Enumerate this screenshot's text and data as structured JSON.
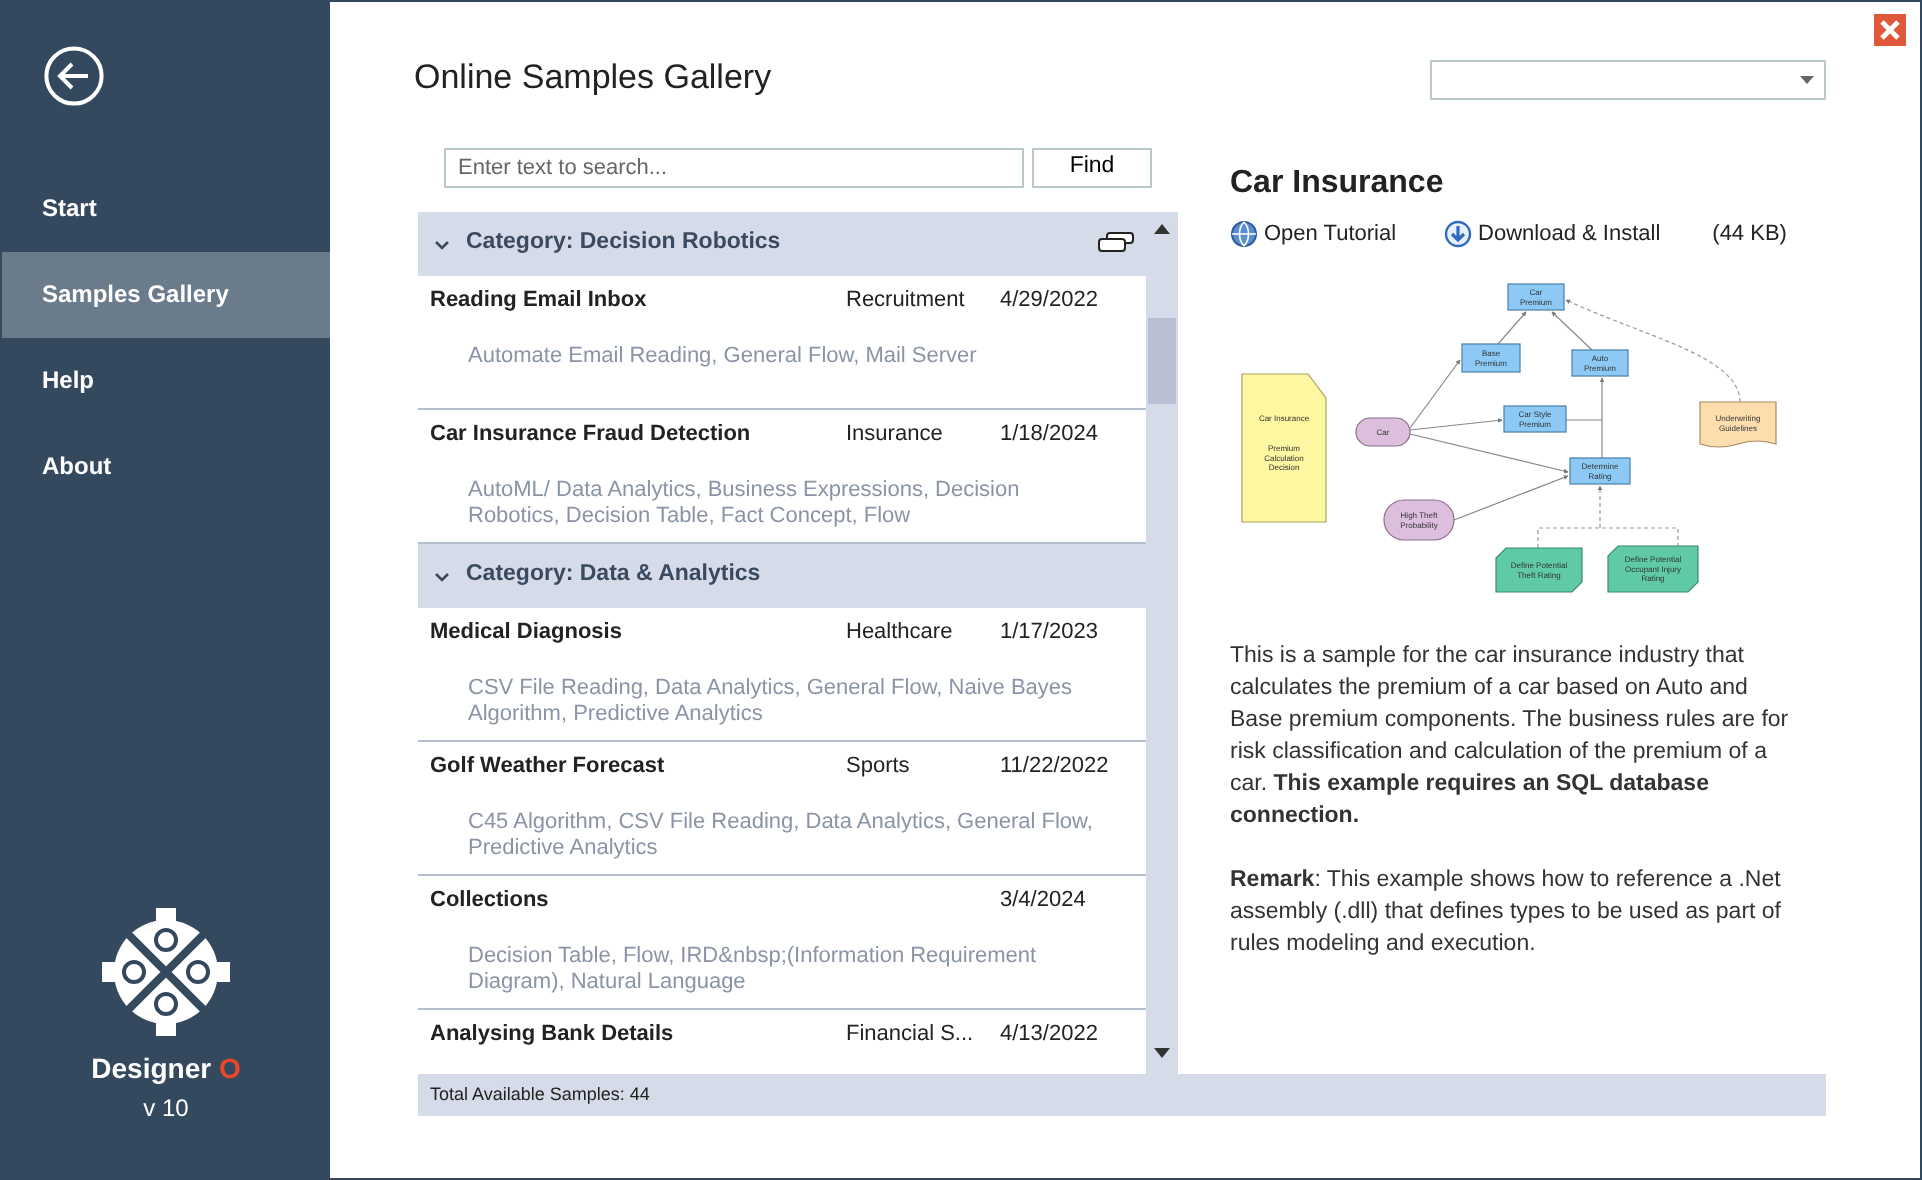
{
  "sidebar": {
    "items": [
      {
        "label": "Start",
        "selected": false
      },
      {
        "label": "Samples Gallery",
        "selected": true
      },
      {
        "label": "Help",
        "selected": false
      },
      {
        "label": "About",
        "selected": false
      }
    ],
    "product": {
      "name": "Designer",
      "accent": "O",
      "version": "v 10"
    }
  },
  "title": "Online Samples Gallery",
  "search": {
    "placeholder": "Enter text to search...",
    "button": "Find"
  },
  "groups": [
    {
      "category": "Category: Decision Robotics",
      "expanded": true,
      "samples": [
        {
          "name": "Reading Email Inbox",
          "industry": "Recruitment",
          "date": "4/29/2022",
          "tags": "Automate Email Reading, General Flow, Mail Server"
        },
        {
          "name": "Car Insurance Fraud Detection",
          "industry": "Insurance",
          "date": "1/18/2024",
          "tags": "AutoML/ Data Analytics, Business Expressions, Decision Robotics, Decision Table, Fact Concept, Flow"
        }
      ]
    },
    {
      "category": "Category: Data & Analytics",
      "expanded": true,
      "samples": [
        {
          "name": "Medical Diagnosis",
          "industry": "Healthcare",
          "date": "1/17/2023",
          "tags": "CSV File Reading, Data Analytics, General Flow, Naive Bayes Algorithm, Predictive Analytics"
        },
        {
          "name": "Golf Weather Forecast",
          "industry": "Sports",
          "date": "11/22/2022",
          "tags": "C45 Algorithm, CSV File Reading, Data Analytics, General Flow, Predictive Analytics"
        },
        {
          "name": "Collections",
          "date": "3/4/2024",
          "tags": "Decision Table, Flow, IRD&nbsp;(Information Requirement Diagram), Natural Language"
        },
        {
          "name": "Analysing Bank Details",
          "industry": "Financial S...",
          "date": "4/13/2022"
        }
      ]
    }
  ],
  "status_bar": "Total Available Samples: 44",
  "detail": {
    "title": "Car Insurance",
    "links": [
      {
        "label": "Open Tutorial",
        "kind": "globe"
      },
      {
        "label": "Download & Install",
        "kind": "download"
      }
    ],
    "size": "(44 KB)",
    "diagram": {
      "nodes": [
        {
          "kind": "decision",
          "lines": [
            "Car",
            "Premium"
          ]
        },
        {
          "kind": "decision",
          "lines": [
            "Base",
            "Premium"
          ]
        },
        {
          "kind": "decision",
          "lines": [
            "Auto",
            "Premium"
          ]
        },
        {
          "kind": "decision",
          "lines": [
            "Car Style",
            "Premium"
          ]
        },
        {
          "kind": "decision",
          "lines": [
            "Determine",
            "Rating"
          ]
        },
        {
          "kind": "input",
          "lines": [
            "Car"
          ]
        },
        {
          "kind": "input",
          "lines": [
            "High Theft",
            "Probability"
          ]
        },
        {
          "kind": "document",
          "lines": [
            "Car Insurance"
          ],
          "sub_lines": [
            "Premium",
            "Calculation",
            "Decision"
          ]
        },
        {
          "kind": "knowledge",
          "lines": [
            "Underwriting",
            "Guidelines"
          ]
        },
        {
          "kind": "source",
          "lines": [
            "Define Potential",
            "Theft Rating"
          ]
        },
        {
          "kind": "source",
          "lines": [
            "Define Potential",
            "Occupant Injury",
            "Rating"
          ]
        }
      ]
    },
    "description": "This is a sample for the car insurance industry that calculates the premium of a car based on Auto and Base premium components. The business rules are for risk classification and calculation of the premium of a car. **This example requires an SQL database connection.**",
    "remark": "**Remark**: This example shows how to reference a .Net assembly (.dll) that defines types to be used as part of rules modeling and execution."
  }
}
